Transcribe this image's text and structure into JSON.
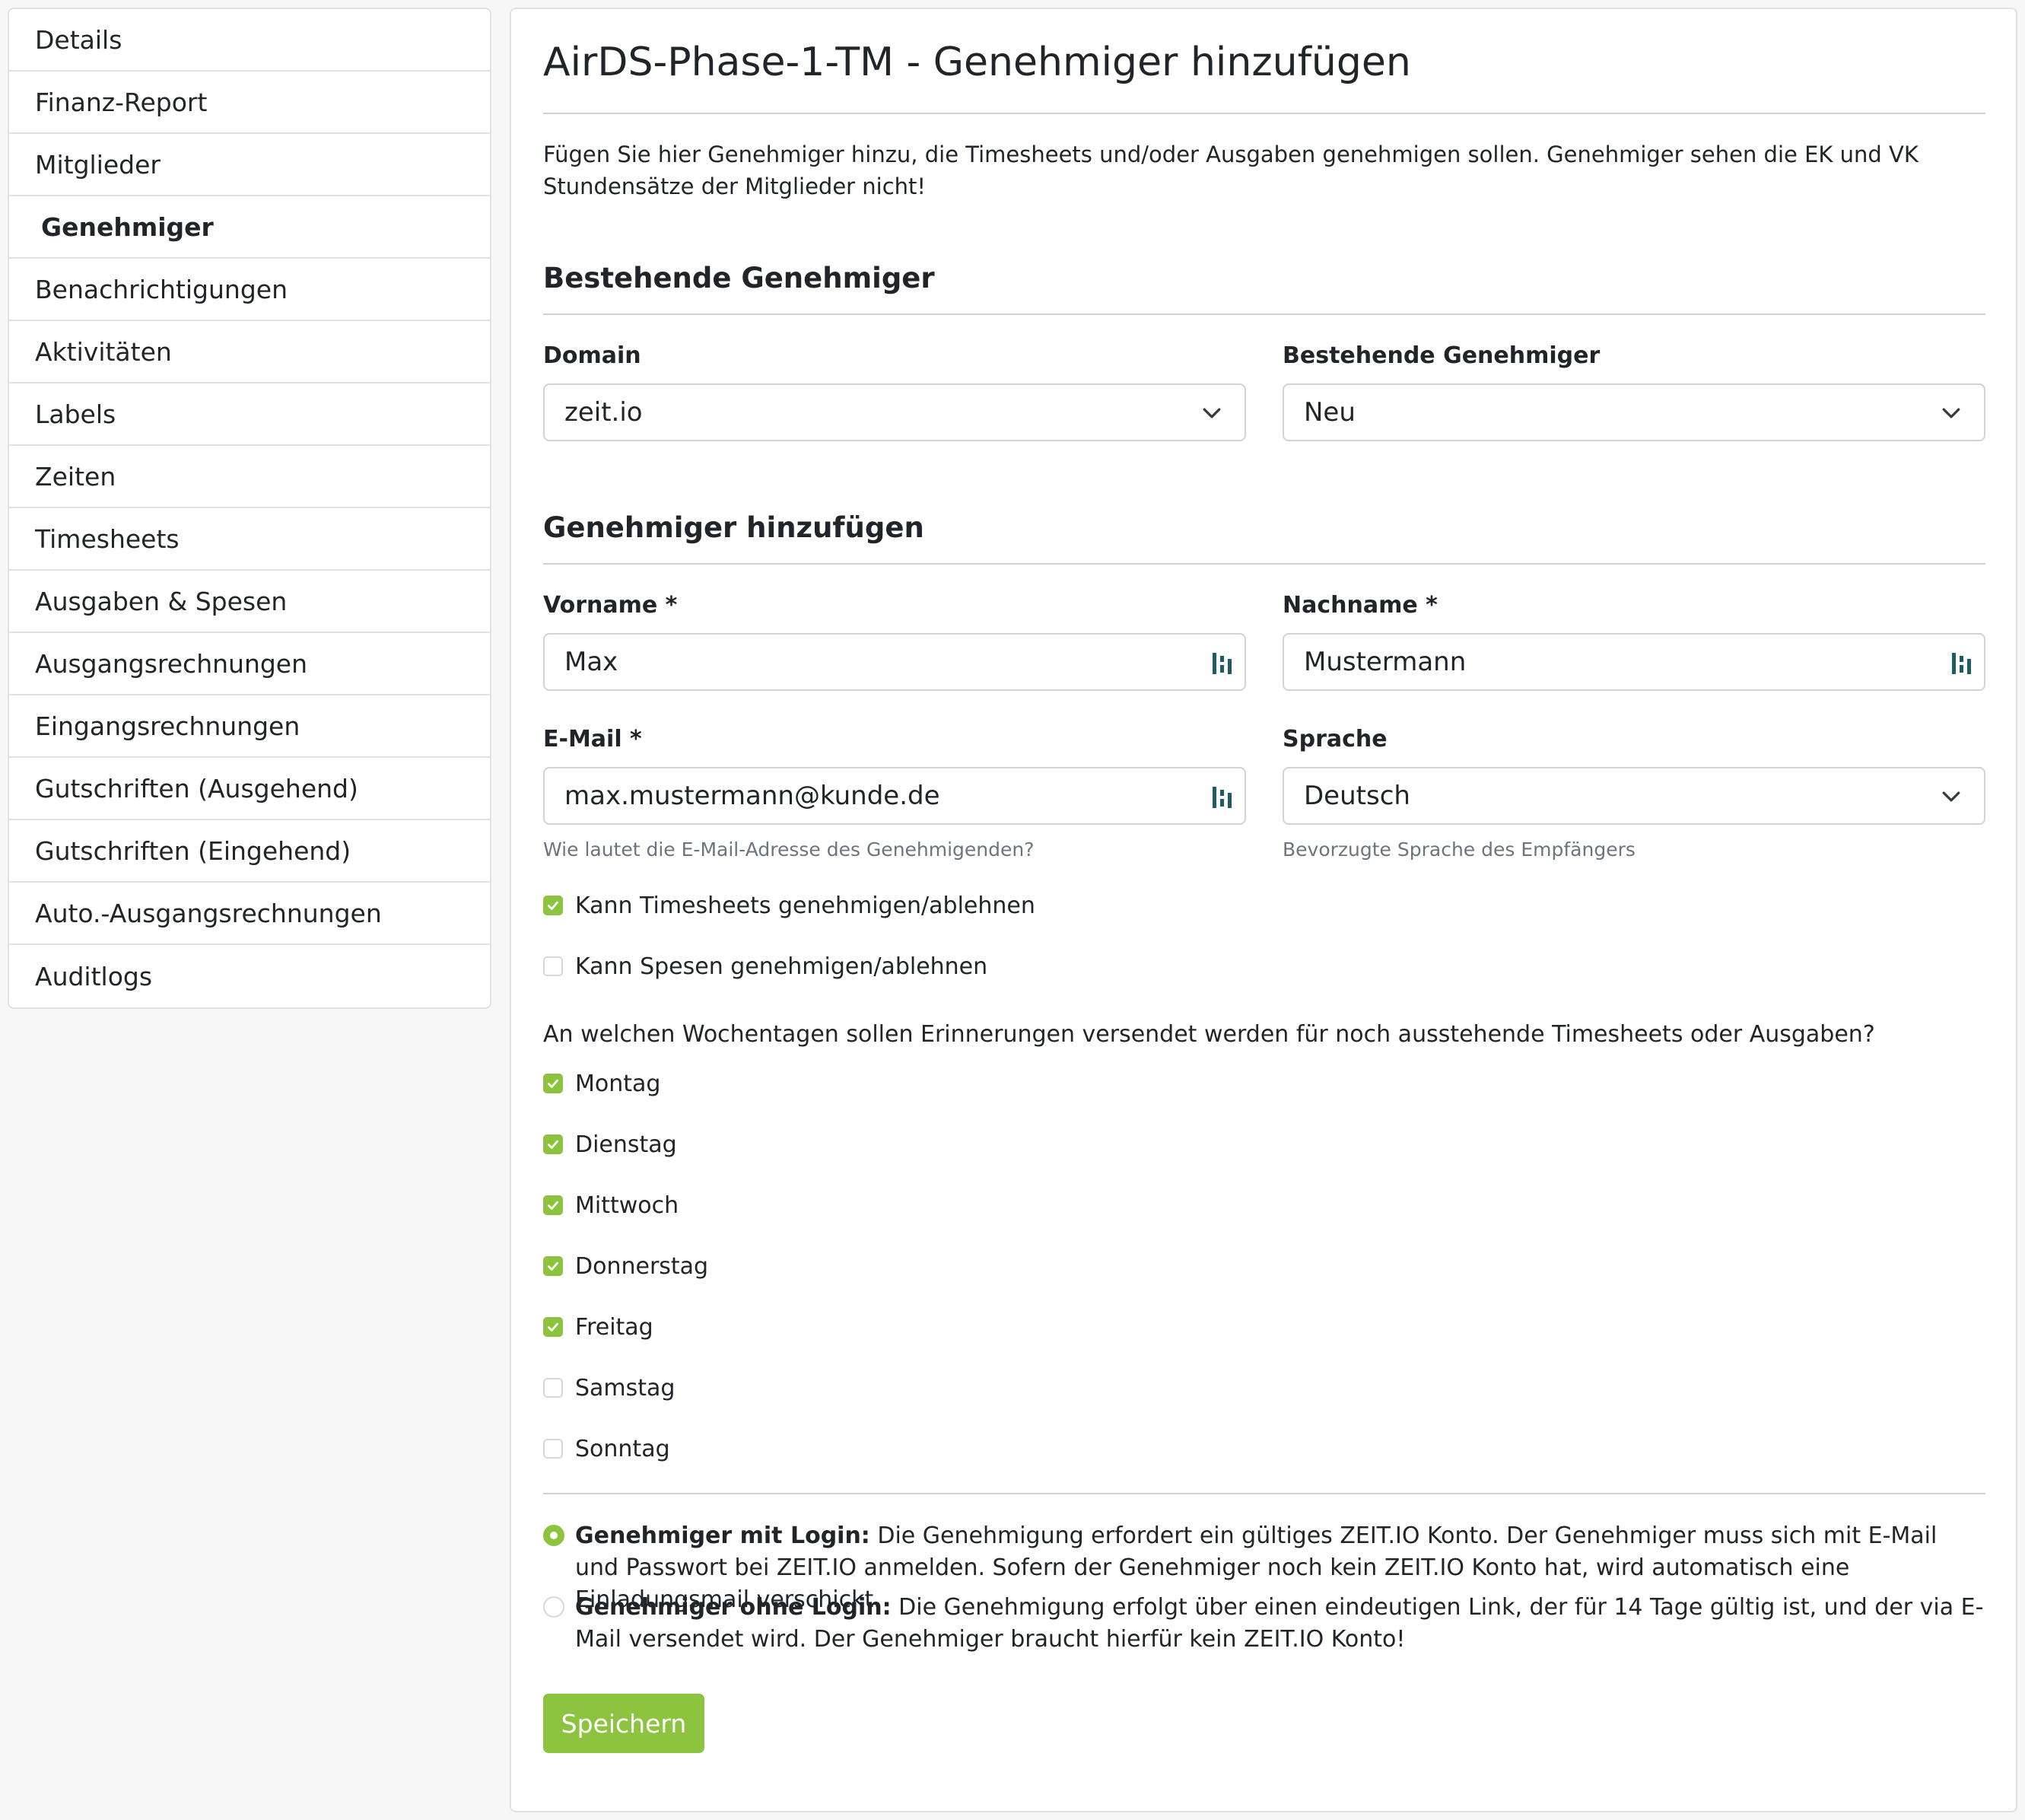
{
  "sidebar": {
    "items": [
      {
        "label": "Details"
      },
      {
        "label": "Finanz-Report"
      },
      {
        "label": "Mitglieder"
      },
      {
        "label": "Genehmiger",
        "active": true
      },
      {
        "label": "Benachrichtigungen"
      },
      {
        "label": "Aktivitäten"
      },
      {
        "label": "Labels"
      },
      {
        "label": "Zeiten"
      },
      {
        "label": "Timesheets"
      },
      {
        "label": "Ausgaben & Spesen"
      },
      {
        "label": "Ausgangsrechnungen"
      },
      {
        "label": "Eingangsrechnungen"
      },
      {
        "label": "Gutschriften (Ausgehend)"
      },
      {
        "label": "Gutschriften (Eingehend)"
      },
      {
        "label": "Auto.-Ausgangsrechnungen"
      },
      {
        "label": "Auditlogs"
      }
    ]
  },
  "main": {
    "title": "AirDS-Phase-1-TM - Genehmiger hinzufügen",
    "intro": "Fügen Sie hier Genehmiger hinzu, die Timesheets und/oder Ausgaben genehmigen sollen. Genehmiger sehen die EK und VK Stunden­sätze der Mitglieder nicht!",
    "existing": {
      "heading": "Bestehende Genehmiger",
      "domain_label": "Domain",
      "domain_value": "zeit.io",
      "approver_label": "Bestehende Genehmiger",
      "approver_value": "Neu"
    },
    "add": {
      "heading": "Genehmiger hinzufügen",
      "firstname_label": "Vorname *",
      "firstname_value": "Max",
      "lastname_label": "Nachname *",
      "lastname_value": "Mustermann",
      "email_label": "E-Mail *",
      "email_value": "max.mustermann@kunde.de",
      "email_help": "Wie lautet die E-Mail-Adresse des Genehmigenden?",
      "language_label": "Sprache",
      "language_value": "Deutsch",
      "language_help": "Bevorzugte Sprache des Empfängers"
    },
    "permissions": [
      {
        "label": "Kann Timesheets genehmigen/ablehnen",
        "checked": true
      },
      {
        "label": "Kann Spesen genehmigen/ablehnen",
        "checked": false
      }
    ],
    "reminder_question": "An welchen Wochentagen sollen Erinnerungen versendet werden für noch ausstehende Timesheets oder Ausgaben?",
    "weekdays": [
      {
        "label": "Montag",
        "checked": true
      },
      {
        "label": "Dienstag",
        "checked": true
      },
      {
        "label": "Mittwoch",
        "checked": true
      },
      {
        "label": "Donnerstag",
        "checked": true
      },
      {
        "label": "Freitag",
        "checked": true
      },
      {
        "label": "Samstag",
        "checked": false
      },
      {
        "label": "Sonntag",
        "checked": false
      }
    ],
    "login_options": [
      {
        "title": "Genehmiger mit Login:",
        "text": " Die Genehmigung erfordert ein gültiges ZEIT.IO Konto. Der Genehmiger muss sich mit E-Mail und Pass­wort bei ZEIT.IO anmelden. Sofern der Genehmiger noch kein ZEIT.IO Konto hat, wird automatisch eine Einladungsmail verschickt.",
        "selected": true
      },
      {
        "title": "Genehmiger ohne Login:",
        "text": " Die Genehmigung erfolgt über einen eindeutigen Link, der für 14 Tage gültig ist, und der via E-Mail versendet wird. Der Genehmiger braucht hierfür kein ZEIT.IO Konto!",
        "selected": false
      }
    ],
    "save_label": "Speichern"
  },
  "colors": {
    "accent": "#8cc43f",
    "border": "#dee2e6",
    "muted_text": "#6c757d"
  },
  "icons": {
    "select": "chevron-down-icon",
    "input_addon": "keypass-icon",
    "checkbox": "check-icon"
  }
}
